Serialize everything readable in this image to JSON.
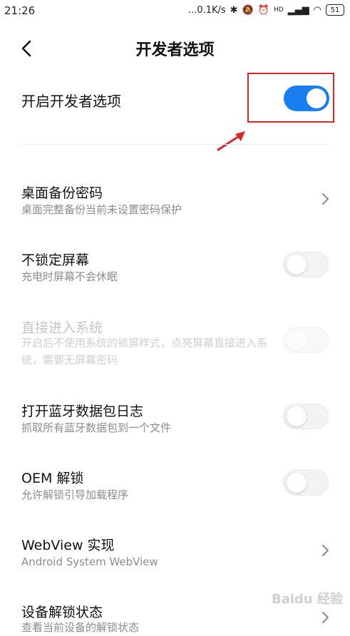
{
  "status_bar": {
    "time": "21:26",
    "net_speed": "...0.1K/s",
    "hd": "HD",
    "battery": "51"
  },
  "header": {
    "title": "开发者选项"
  },
  "master": {
    "label": "开启开发者选项",
    "toggle_on": true
  },
  "items": [
    {
      "title": "桌面备份密码",
      "subtitle": "桌面完整备份当前未设置密码保护",
      "control": "chevron"
    },
    {
      "title": "不锁定屏幕",
      "subtitle": "充电时屏幕不会休眠",
      "control": "toggle-off"
    },
    {
      "title": "直接进入系统",
      "subtitle": "开启后不使用系统的锁屏样式，点亮屏幕直接进入系统，需要无屏幕密码",
      "control": "toggle-disabled"
    },
    {
      "title": "打开蓝牙数据包日志",
      "subtitle": "抓取所有蓝牙数据包到一个文件",
      "control": "toggle-off"
    },
    {
      "title": "OEM 解锁",
      "subtitle": "允许解锁引导加载程序",
      "control": "toggle-off"
    },
    {
      "title": "WebView 实现",
      "subtitle": "Android System WebView",
      "control": "chevron"
    },
    {
      "title": "设备解锁状态",
      "subtitle": "查看当前设备的解锁状态",
      "control": "chevron"
    }
  ],
  "annotation": {
    "highlight_color": "#d8262c"
  },
  "colors": {
    "accent": "#1a7ef0"
  },
  "watermark": "Baidu 经验"
}
